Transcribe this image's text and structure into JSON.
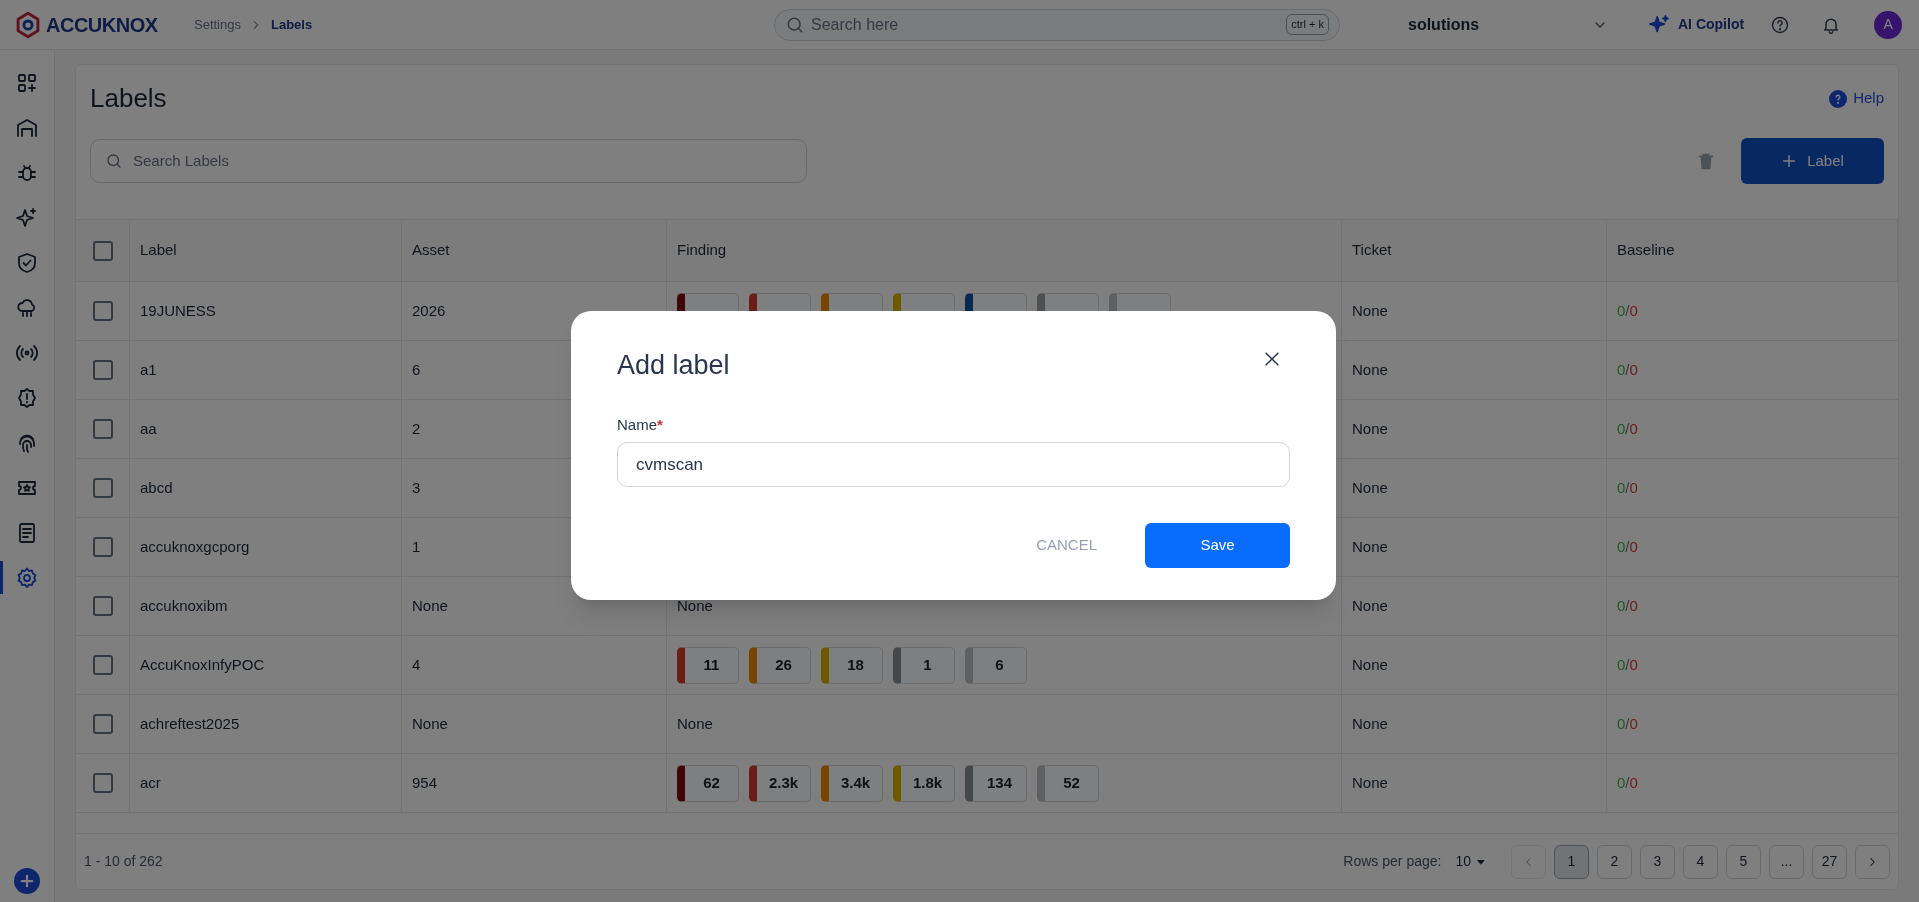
{
  "topbar": {
    "logo": "ACCUKNOX",
    "breadcrumb": [
      "Settings",
      "Labels"
    ],
    "search": {
      "placeholder": "Search here",
      "shortcut": "ctrl + k"
    },
    "workspace": "solutions",
    "copilot": "AI Copilot",
    "avatar": "A"
  },
  "sidebar": {
    "items": [
      {
        "selected": false
      },
      {
        "selected": false
      },
      {
        "selected": false
      },
      {
        "selected": false
      },
      {
        "selected": false
      },
      {
        "selected": false
      },
      {
        "selected": false
      },
      {
        "selected": false
      },
      {
        "selected": false
      },
      {
        "selected": false
      },
      {
        "selected": false
      },
      {
        "selected": true
      }
    ]
  },
  "page": {
    "title": "Labels",
    "help": "Help",
    "search": {
      "placeholder": "Search Labels"
    },
    "add_button": "Label"
  },
  "table": {
    "all_checked": false,
    "columns": [
      "Label",
      "Asset",
      "Finding",
      "Ticket",
      "Baseline"
    ],
    "rows": [
      {
        "label": "19JUNESS",
        "asset": "2026",
        "findings": [
          {
            "color": "#3d0808"
          },
          {
            "color": "#6b1d18"
          },
          {
            "color": "#784500"
          },
          {
            "color": "#6d5a00"
          },
          {
            "color": "#07284f"
          },
          {
            "color": "#4d5053"
          },
          {
            "color": "#5d5f62"
          }
        ],
        "ticket": "None",
        "baseline": {
          "passed": "0",
          "separator": "/",
          "failed": "0"
        },
        "checked": false
      },
      {
        "label": "a1",
        "asset": "6",
        "ticket": "None",
        "baseline": {
          "passed": "0",
          "separator": "/",
          "failed": "0"
        },
        "checked": false
      },
      {
        "label": "aa",
        "asset": "2",
        "ticket": "None",
        "baseline": {
          "passed": "0",
          "separator": "/",
          "failed": "0"
        },
        "checked": false
      },
      {
        "label": "abcd",
        "asset": "3",
        "ticket": "None",
        "baseline": {
          "passed": "0",
          "separator": "/",
          "failed": "0"
        },
        "checked": false
      },
      {
        "label": "accuknoxgcporg",
        "asset": "1",
        "ticket": "None",
        "baseline": {
          "passed": "0",
          "separator": "/",
          "failed": "0"
        },
        "checked": false
      },
      {
        "label": "accuknoxibm",
        "asset": "None",
        "finding_text": "None",
        "ticket": "None",
        "baseline": {
          "passed": "0",
          "separator": "/",
          "failed": "0"
        },
        "checked": false
      },
      {
        "label": "AccuKnoxInfyPOC",
        "asset": "4",
        "findings": [
          {
            "value": "11",
            "color": "#6b1d18"
          },
          {
            "value": "26",
            "color": "#784500"
          },
          {
            "value": "18",
            "color": "#6d5a00"
          },
          {
            "value": "1",
            "color": "#45484b"
          },
          {
            "value": "6",
            "color": "#5d5f62"
          }
        ],
        "ticket": "None",
        "baseline": {
          "passed": "0",
          "separator": "/",
          "failed": "0"
        },
        "checked": false
      },
      {
        "label": "achreftest2025",
        "asset": "None",
        "finding_text": "None",
        "ticket": "None",
        "baseline": {
          "passed": "0",
          "separator": "/",
          "failed": "0"
        },
        "checked": false
      },
      {
        "label": "acr",
        "asset": "954",
        "findings": [
          {
            "value": "62",
            "color": "#3d0808"
          },
          {
            "value": "2.3k",
            "color": "#6b1d18"
          },
          {
            "value": "3.4k",
            "color": "#784500"
          },
          {
            "value": "1.8k",
            "color": "#6d5a00"
          },
          {
            "value": "134",
            "color": "#45484b"
          },
          {
            "value": "52",
            "color": "#5d5f62"
          }
        ],
        "ticket": "None",
        "baseline": {
          "passed": "0",
          "separator": "/",
          "failed": "0"
        },
        "checked": false
      }
    ]
  },
  "pagination": {
    "summary": "1 - 10 of 262",
    "rows_label": "Rows per page:",
    "rows_value": "10",
    "pages": [
      {
        "label": "1",
        "selected": true
      },
      {
        "label": "2",
        "selected": false
      },
      {
        "label": "3",
        "selected": false
      },
      {
        "label": "4",
        "selected": false
      },
      {
        "label": "5",
        "selected": false
      },
      {
        "label": "...",
        "selected": false
      },
      {
        "label": "27",
        "selected": false
      }
    ]
  },
  "dialog": {
    "title": "Add label",
    "field_label": "Name",
    "required_mark": "*",
    "value": "cvmscan",
    "cancel": "CANCEL",
    "save": "Save"
  }
}
